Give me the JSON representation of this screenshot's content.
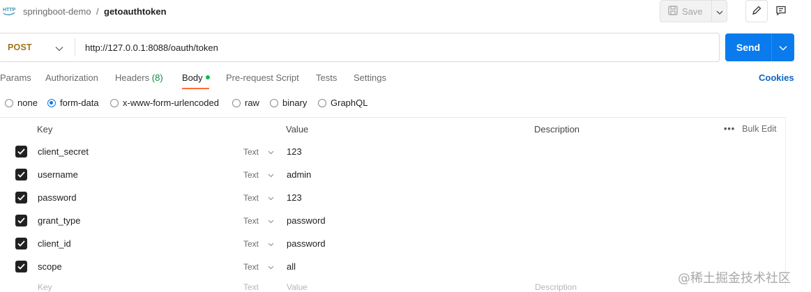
{
  "breadcrumb": {
    "workspace": "springboot-demo",
    "separator": "/",
    "request": "getoauthtoken"
  },
  "toolbar": {
    "save_label": "Save"
  },
  "request": {
    "method": "POST",
    "url": "http://127.0.0.1:8088/oauth/token",
    "send_label": "Send"
  },
  "tabs": {
    "params": "Params",
    "authorization": "Authorization",
    "headers": "Headers",
    "headers_count": "(8)",
    "body": "Body",
    "prerequest": "Pre-request Script",
    "tests": "Tests",
    "settings": "Settings",
    "cookies": "Cookies"
  },
  "body_types": [
    {
      "label": "none",
      "selected": false
    },
    {
      "label": "form-data",
      "selected": true
    },
    {
      "label": "x-www-form-urlencoded",
      "selected": false
    },
    {
      "label": "raw",
      "selected": false
    },
    {
      "label": "binary",
      "selected": false
    },
    {
      "label": "GraphQL",
      "selected": false
    }
  ],
  "table": {
    "headers": {
      "key": "Key",
      "value": "Value",
      "description": "Description",
      "bulk_edit": "Bulk Edit"
    },
    "rows": [
      {
        "key": "client_secret",
        "type": "Text",
        "value": "123",
        "checked": true
      },
      {
        "key": "username",
        "type": "Text",
        "value": "admin",
        "checked": true
      },
      {
        "key": "password",
        "type": "Text",
        "value": "123",
        "checked": true
      },
      {
        "key": "grant_type",
        "type": "Text",
        "value": "password",
        "checked": true
      },
      {
        "key": "client_id",
        "type": "Text",
        "value": "password",
        "checked": true
      },
      {
        "key": "scope",
        "type": "Text",
        "value": "all",
        "checked": true
      }
    ],
    "placeholder": {
      "key": "Key",
      "type": "Text",
      "value": "Value",
      "description": "Description"
    }
  },
  "watermark": "@稀土掘金技术社区",
  "colors": {
    "accent": "#097bed",
    "method_post": "#a0731a",
    "tab_indicator": "#ff6c37",
    "cookies_link": "#0b65c2"
  }
}
